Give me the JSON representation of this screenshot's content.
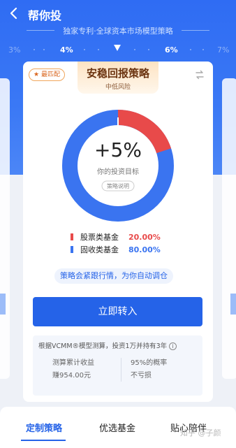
{
  "header": {
    "back_icon": "chevron-left-icon",
    "title": "帮你投",
    "subtitle": "独家专利·全球资本市场模型策略"
  },
  "rate_scale": {
    "labels": [
      "3%",
      "4%",
      "6%",
      "7%"
    ],
    "selected_range": "4%–6%"
  },
  "card": {
    "badge": "最匹配",
    "strategy_name": "安稳回报策略",
    "risk_level": "中低风险",
    "swap_icon": "swap-icon",
    "target_value": "+5%",
    "target_label": "你的投资目标",
    "explain_label": "策略说明",
    "allocation": [
      {
        "name": "股票类基金",
        "percent": "20.00%",
        "fraction": 0.2,
        "color": "#e84a4a"
      },
      {
        "name": "固收类基金",
        "percent": "80.00%",
        "fraction": 0.8,
        "color": "#3a74f0"
      }
    ],
    "tracking_note": "策略会紧跟行情，为你自动调仓",
    "cta_label": "立即转入",
    "info": {
      "line": "根据VCMM®模型测算，投资1万并持有3年",
      "info_icon": "info-icon",
      "left_label": "测算累计收益",
      "left_value": "赚954.00元",
      "right_label": "95%的概率",
      "right_value": "不亏损"
    }
  },
  "tabs": [
    "定制策略",
    "优选基金",
    "贴心陪伴"
  ],
  "watermark": "知乎 @子颜"
}
